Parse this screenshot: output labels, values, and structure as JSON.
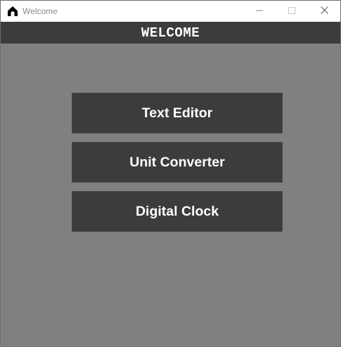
{
  "window": {
    "title": "Welcome",
    "app_icon": "home-icon",
    "controls": {
      "minimize_icon": "minimize-icon",
      "maximize_icon": "maximize-icon",
      "close_icon": "close-icon"
    }
  },
  "header": {
    "title": "WELCOME"
  },
  "menu": {
    "buttons": [
      {
        "label": "Text Editor"
      },
      {
        "label": "Unit Converter"
      },
      {
        "label": "Digital Clock"
      }
    ]
  },
  "colors": {
    "background": "#808080",
    "header_background": "#3c3c3c",
    "button_background": "#3c3c3c",
    "button_text": "#ffffff",
    "titlebar_background": "#ffffff"
  }
}
